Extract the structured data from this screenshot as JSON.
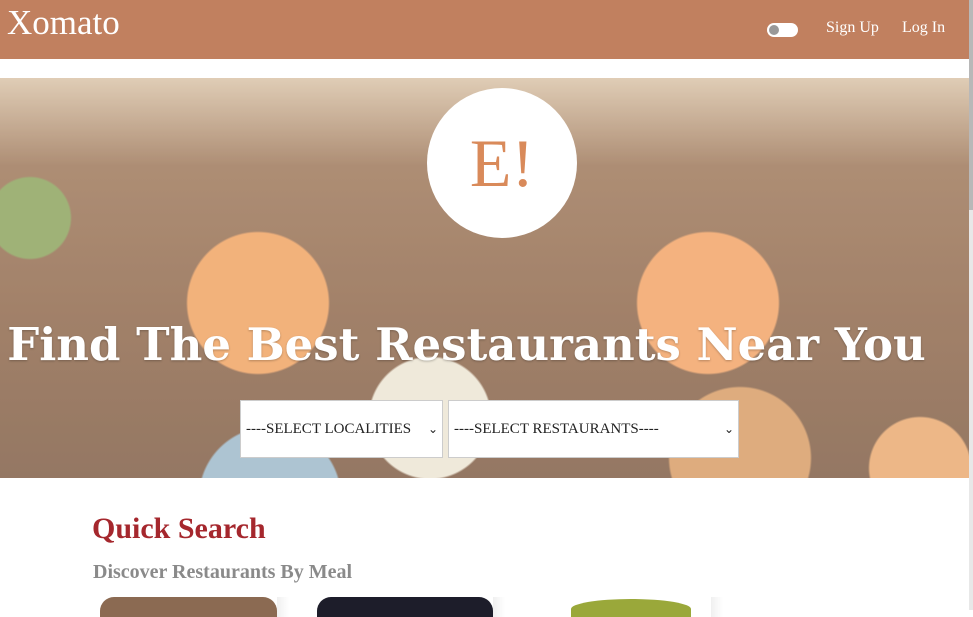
{
  "navbar": {
    "brand": "Xomato",
    "signup_label": "Sign Up",
    "login_label": "Log In",
    "theme_toggle_icon": "toggle-switch",
    "background_color": "#c1805f"
  },
  "hero": {
    "logo_text": "E!",
    "title": "Find The Best Restaurants Near You",
    "localities_select": "----SELECT LOCALITIES",
    "restaurants_select": "----SELECT RESTAURANTS----"
  },
  "quick_search": {
    "title": "Quick Search",
    "subtitle": "Discover Restaurants By Meal",
    "title_color": "#a5272d"
  }
}
